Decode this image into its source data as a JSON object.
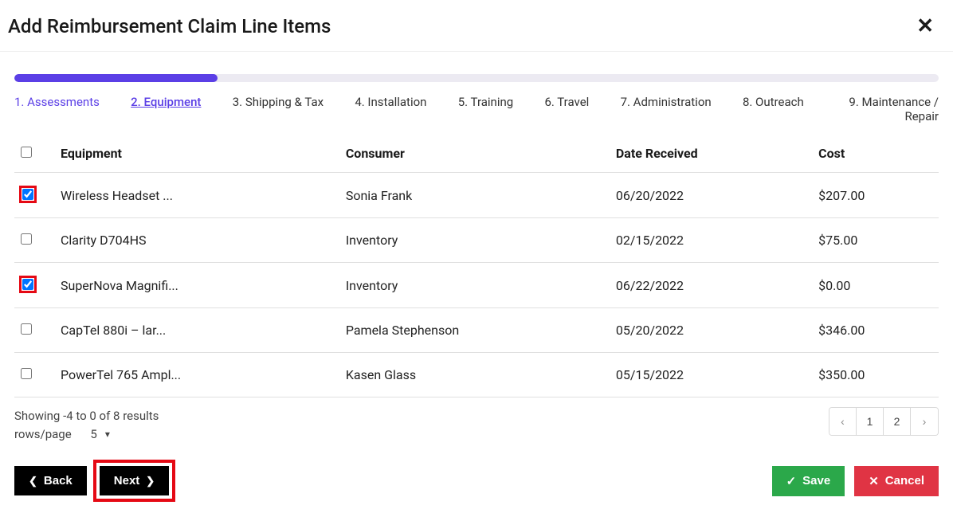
{
  "title": "Add Reimbursement Claim Line Items",
  "progress_percent": 22,
  "steps": [
    {
      "label": "1. Assessments",
      "state": "active"
    },
    {
      "label": "2. Equipment",
      "state": "current"
    },
    {
      "label": "3. Shipping & Tax",
      "state": ""
    },
    {
      "label": "4. Installation",
      "state": ""
    },
    {
      "label": "5. Training",
      "state": ""
    },
    {
      "label": "6. Travel",
      "state": ""
    },
    {
      "label": "7. Administration",
      "state": ""
    },
    {
      "label": "8. Outreach",
      "state": ""
    },
    {
      "label": "9. Maintenance / Repair",
      "state": "last"
    }
  ],
  "columns": {
    "equipment": "Equipment",
    "consumer": "Consumer",
    "date_received": "Date Received",
    "cost": "Cost"
  },
  "rows": [
    {
      "checked": true,
      "highlighted": true,
      "equipment": "Wireless Headset ...",
      "consumer": "Sonia Frank",
      "date": "06/20/2022",
      "cost": "$207.00"
    },
    {
      "checked": false,
      "highlighted": false,
      "equipment": "Clarity D704HS",
      "consumer": "Inventory",
      "date": "02/15/2022",
      "cost": "$75.00"
    },
    {
      "checked": true,
      "highlighted": true,
      "equipment": "SuperNova Magnifi...",
      "consumer": "Inventory",
      "date": "06/22/2022",
      "cost": "$0.00"
    },
    {
      "checked": false,
      "highlighted": false,
      "equipment": "CapTel 880i – lar...",
      "consumer": "Pamela Stephenson",
      "date": "05/20/2022",
      "cost": "$346.00"
    },
    {
      "checked": false,
      "highlighted": false,
      "equipment": "PowerTel 765 Ampl...",
      "consumer": "Kasen Glass",
      "date": "05/15/2022",
      "cost": "$350.00"
    }
  ],
  "results_text": "Showing -4 to 0 of 8 results",
  "rows_label": "rows/page",
  "rows_value": "5",
  "pages": [
    "1",
    "2"
  ],
  "buttons": {
    "back": "Back",
    "next": "Next",
    "save": "Save",
    "cancel": "Cancel"
  }
}
